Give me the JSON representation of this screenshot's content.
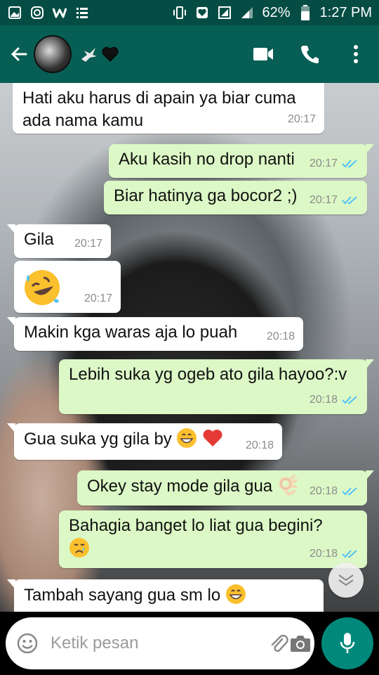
{
  "status_bar": {
    "battery": "62%",
    "time": "1:27 PM"
  },
  "header": {
    "contact_icons": [
      "bird-icon",
      "black-heart-icon"
    ]
  },
  "messages": [
    {
      "dir": "in",
      "text": "Hati aku harus di apain ya biar cuma ada nama kamu",
      "time": "20:17"
    },
    {
      "dir": "out",
      "text": "Aku kasih no drop nanti",
      "time": "20:17",
      "read": true
    },
    {
      "dir": "out",
      "text": "Biar hatinya ga bocor2 ;)",
      "time": "20:17",
      "read": true
    },
    {
      "dir": "in",
      "text": "Gila",
      "time": "20:17"
    },
    {
      "dir": "in",
      "emoji": "rolling-on-floor-laughing",
      "time": "20:17"
    },
    {
      "dir": "in",
      "text": "Makin kga waras aja lo puah",
      "time": "20:18"
    },
    {
      "dir": "out",
      "text": "Lebih suka yg ogeb ato gila hayoo?:v",
      "time": "20:18",
      "read": true
    },
    {
      "dir": "in",
      "text": "Gua suka yg gila by",
      "emojis": [
        "grinning-face",
        "red-heart"
      ],
      "time": "20:18"
    },
    {
      "dir": "out",
      "text": "Okey stay mode gila gua",
      "emojis": [
        "ok-hand"
      ],
      "time": "20:18",
      "read": true
    },
    {
      "dir": "out",
      "text": "Bahagia banget lo liat gua begini?",
      "emojis": [
        "crying-face"
      ],
      "time": "20:18",
      "read": true
    },
    {
      "dir": "in",
      "text": "Tambah sayang gua sm lo",
      "emojis": [
        "grinning-face"
      ],
      "time": ""
    }
  ],
  "input": {
    "placeholder": "Ketik pesan"
  },
  "colors": {
    "header": "#075e54",
    "statusbar": "#054d44",
    "outgoing": "#dcf8c6",
    "incoming": "#ffffff",
    "ticks": "#4fc3f7",
    "mic": "#00897b"
  }
}
